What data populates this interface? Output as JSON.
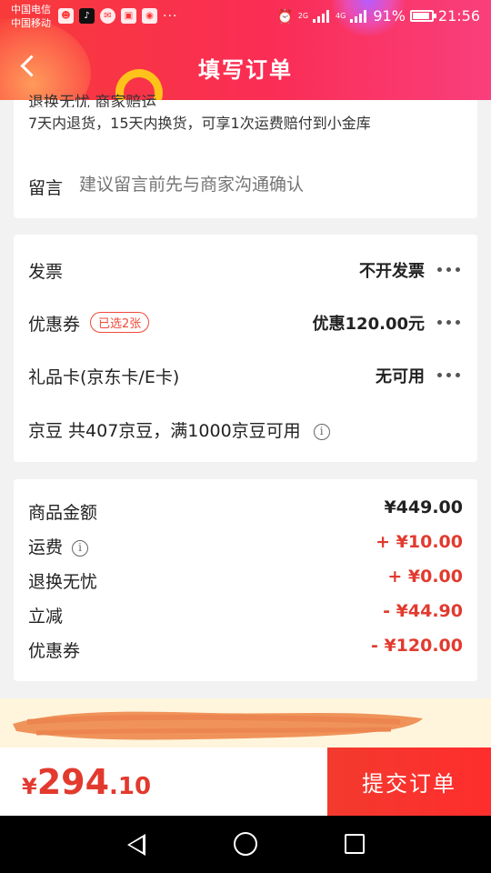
{
  "status_bar": {
    "carrier_1": "中国电信",
    "carrier_2": "中国移动",
    "network_1": "2G",
    "network_2": "4G",
    "battery": "91%",
    "time": "21:56",
    "more": "···"
  },
  "header": {
    "title": "填写订单"
  },
  "service": {
    "title_cut": "退换无忧 商家赔运",
    "description": "7天内退货，15天内换货，可享1次运费赔付到小金库"
  },
  "message": {
    "label": "留言",
    "placeholder": "建议留言前先与商家沟通确认"
  },
  "options": {
    "invoice_label": "发票",
    "invoice_value": "不开发票",
    "coupon_label": "优惠券",
    "coupon_badge": "已选2张",
    "coupon_value": "优惠120.00元",
    "giftcard_label": "礼品卡(京东卡/E卡)",
    "giftcard_value": "无可用",
    "beans_text": "京豆 共407京豆，满1000京豆可用"
  },
  "prices": {
    "goods_label": "商品金额",
    "goods_amount": "¥449.00",
    "shipping_label": "运费",
    "shipping_amount": "+ ¥10.00",
    "worry_free_label": "退换无忧",
    "worry_free_amount": "+ ¥0.00",
    "discount_label": "立减",
    "discount_amount": "- ¥44.90",
    "coupon_label": "优惠券",
    "coupon_amount": "- ¥120.00"
  },
  "checkout": {
    "currency": "¥",
    "total_int": "294",
    "total_dec": ".10",
    "submit_label": "提交订单"
  },
  "colors": {
    "accent_red": "#e23a2e",
    "header_red": "#fa2d55",
    "scribble": "#f0935a"
  },
  "icons": [
    "chevron-left-icon",
    "info-icon",
    "more-dots-icon",
    "alarm-icon",
    "signal-icon",
    "battery-icon",
    "nav-back-icon",
    "nav-home-icon",
    "nav-recent-icon"
  ]
}
